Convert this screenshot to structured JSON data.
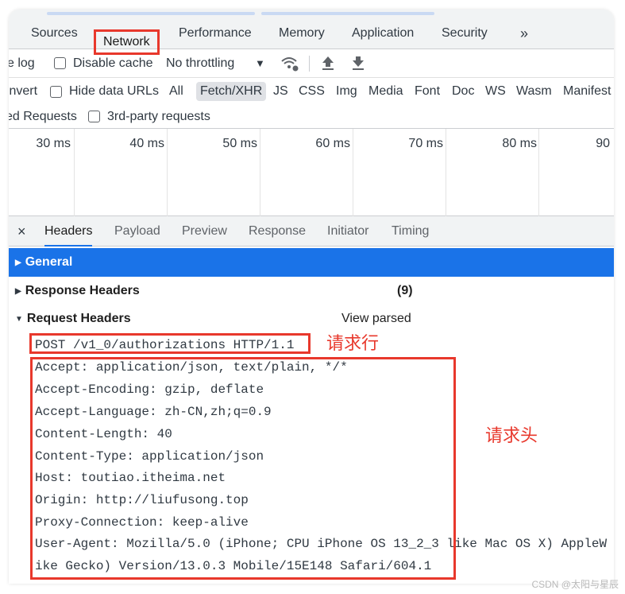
{
  "devtools_tabs": [
    "Sources",
    "Network",
    "Performance",
    "Memory",
    "Application",
    "Security"
  ],
  "active_tab": "Network",
  "more_tabs_icon": "»",
  "toolbar1": {
    "preserve_log_fragment": "e log",
    "disable_cache": "Disable cache",
    "throttling": "No throttling",
    "dropdown_arrow": "▼"
  },
  "toolbar2": {
    "invert": "Invert",
    "hide_data_urls": "Hide data URLs",
    "filters": [
      "All",
      "Fetch/XHR",
      "JS",
      "CSS",
      "Img",
      "Media",
      "Font",
      "Doc",
      "WS",
      "Wasm",
      "Manifest"
    ],
    "active_filter": "Fetch/XHR"
  },
  "toolbar3": {
    "blocked_requests_fragment": "ed Requests",
    "third_party": "3rd-party requests"
  },
  "timeline_ticks": [
    "30 ms",
    "40 ms",
    "50 ms",
    "60 ms",
    "70 ms",
    "80 ms",
    "90"
  ],
  "detail_tabs": [
    "Headers",
    "Payload",
    "Preview",
    "Response",
    "Initiator",
    "Timing"
  ],
  "active_detail_tab": "Headers",
  "close_icon": "×",
  "sections": {
    "general": "General",
    "response_headers": "Response Headers",
    "response_count": "(9)",
    "request_headers": "Request Headers",
    "view_parsed": "View parsed"
  },
  "request_line": "POST /v1_0/authorizations HTTP/1.1",
  "request_headers": [
    "Accept: application/json, text/plain, */*",
    "Accept-Encoding: gzip, deflate",
    "Accept-Language: zh-CN,zh;q=0.9",
    "Content-Length: 40",
    "Content-Type: application/json",
    "Host: toutiao.itheima.net",
    "Origin: http://liufusong.top",
    "Proxy-Connection: keep-alive",
    "User-Agent: Mozilla/5.0 (iPhone; CPU iPhone OS 13_2_3 like Mac OS X) AppleW",
    "ike Gecko) Version/13.0.3 Mobile/15E148 Safari/604.1"
  ],
  "annotations": {
    "request_line_label": "请求行",
    "request_headers_label": "请求头"
  },
  "watermark": "CSDN @太阳与星辰",
  "colors": {
    "highlight_red": "#e8382c",
    "selected_blue": "#1a73e8"
  }
}
